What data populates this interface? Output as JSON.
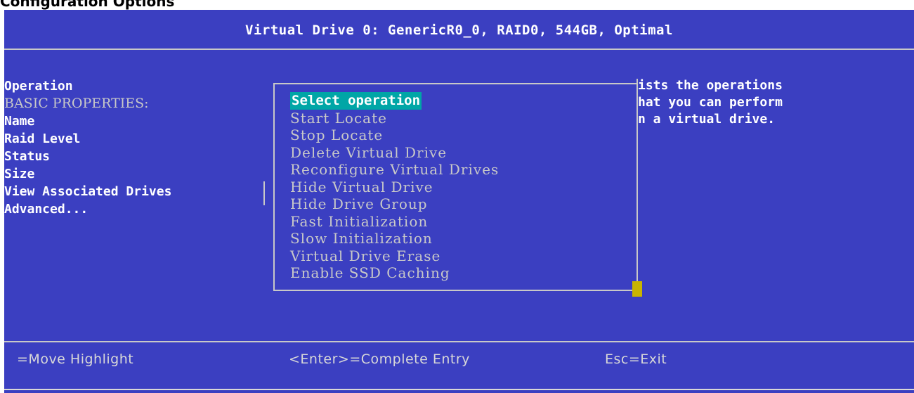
{
  "top_strip_text": "Configuration Options",
  "title": "Virtual Drive 0: GenericR0_0, RAID0, 544GB, Optimal",
  "left_menu": {
    "operation": "Operation",
    "basic_properties": "BASIC PROPERTIES:",
    "name": "Name",
    "raid_level": "Raid Level",
    "status": "Status",
    "size": "Size",
    "view_associated_drives": "View Associated Drives",
    "advanced": "Advanced..."
  },
  "popup": {
    "options": [
      "Select operation",
      "Start Locate",
      "Stop Locate",
      "Delete Virtual Drive",
      "Reconfigure Virtual Drives",
      "Hide Virtual Drive",
      "Hide Drive Group",
      "Fast Initialization",
      "Slow Initialization",
      "Virtual Drive Erase",
      "Enable SSD Caching"
    ],
    "selected_index": 0
  },
  "help_text": [
    "ists the operations",
    "hat you can perform",
    "n a virtual drive."
  ],
  "footer": {
    "move": "=Move Highlight",
    "enter": "<Enter>=Complete Entry",
    "esc": "Esc=Exit"
  },
  "colors": {
    "background": "#3b3fc1",
    "highlight": "#00a6a6",
    "scroll_thumb": "#c8b400",
    "text": "#ffffff",
    "dim_text": "#c8c8c8"
  }
}
